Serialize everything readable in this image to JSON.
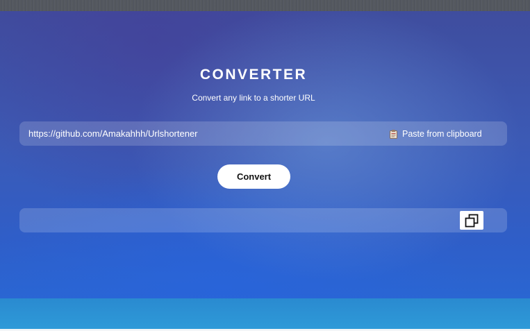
{
  "header": {
    "title": "CONVERTER",
    "subtitle": "Convert any link to a shorter URL"
  },
  "form": {
    "url_value": "https://github.com/Amakahhh/Urlshortener",
    "paste_label": "Paste from clipboard",
    "paste_icon": "clipboard-icon",
    "convert_label": "Convert"
  },
  "result": {
    "value": "",
    "copy_icon": "copy-icon"
  },
  "colors": {
    "panel_top": "#3f4d9e",
    "panel_bottom": "#2a66d2",
    "button_bg": "#ffffff",
    "text": "#ffffff"
  }
}
